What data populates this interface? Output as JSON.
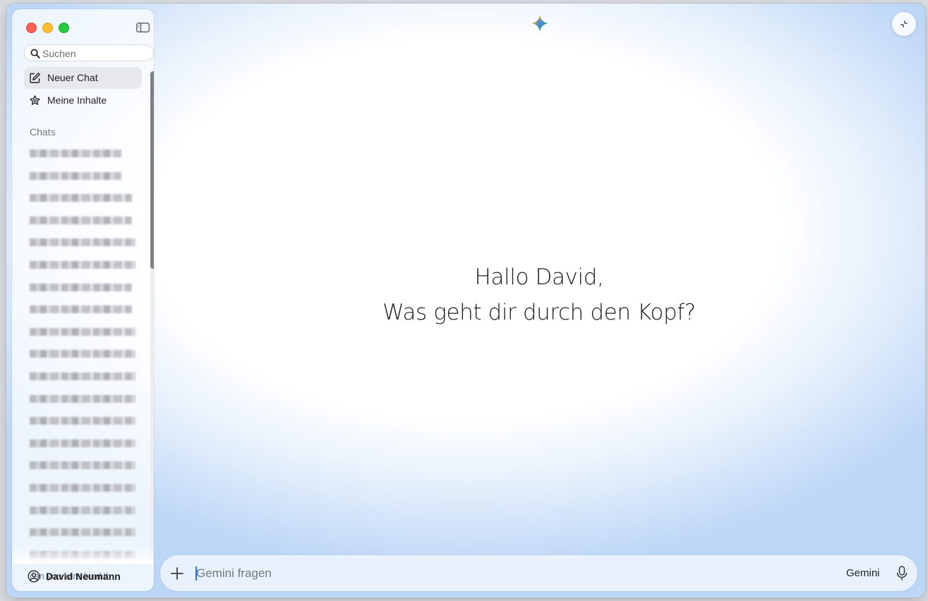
{
  "window": {
    "traffic_lights": [
      "close",
      "minimize",
      "zoom"
    ]
  },
  "sidebar": {
    "toggle_icon": "sidebar-icon",
    "search": {
      "placeholder": "Suchen",
      "icon": "search-icon"
    },
    "nav": [
      {
        "label": "Neuer Chat",
        "icon": "edit-icon",
        "active": true
      },
      {
        "label": "Meine Inhalte",
        "icon": "star-icon",
        "active": false
      }
    ],
    "chats_heading": "Chats",
    "chats": [
      {
        "title": "",
        "blurred": true
      },
      {
        "title": "",
        "blurred": true
      },
      {
        "title": "",
        "blurred": true
      },
      {
        "title": "",
        "blurred": true
      },
      {
        "title": "",
        "blurred": true
      },
      {
        "title": "",
        "blurred": true
      },
      {
        "title": "",
        "blurred": true
      },
      {
        "title": "",
        "blurred": true
      },
      {
        "title": "",
        "blurred": true
      },
      {
        "title": "",
        "blurred": true
      },
      {
        "title": "",
        "blurred": true
      },
      {
        "title": "",
        "blurred": true
      },
      {
        "title": "",
        "blurred": true
      },
      {
        "title": "",
        "blurred": true
      },
      {
        "title": "",
        "blurred": true
      },
      {
        "title": "",
        "blurred": true
      },
      {
        "title": "",
        "blurred": true
      },
      {
        "title": "",
        "blurred": true
      },
      {
        "title": "",
        "blurred": true
      },
      {
        "title": "can you wire bind th",
        "blurred": false
      }
    ],
    "user": {
      "name": "David Neumann",
      "icon": "account-circle-icon"
    }
  },
  "main": {
    "logo_icon": "gemini-sparkle-icon",
    "collapse_icon": "collapse-arrows-icon",
    "greeting_line1": "Hallo David,",
    "greeting_line2": "Was geht dir durch den Kopf?",
    "composer": {
      "placeholder": "Gemini fragen",
      "add_icon": "plus-icon",
      "model_label": "Gemini",
      "mic_icon": "microphone-icon"
    }
  },
  "colors": {
    "accent": "#1a73e8",
    "gemini_blue": "#4285f4",
    "gemini_red": "#ea4335",
    "gemini_yellow": "#fbbc04",
    "gemini_green": "#34a853"
  }
}
